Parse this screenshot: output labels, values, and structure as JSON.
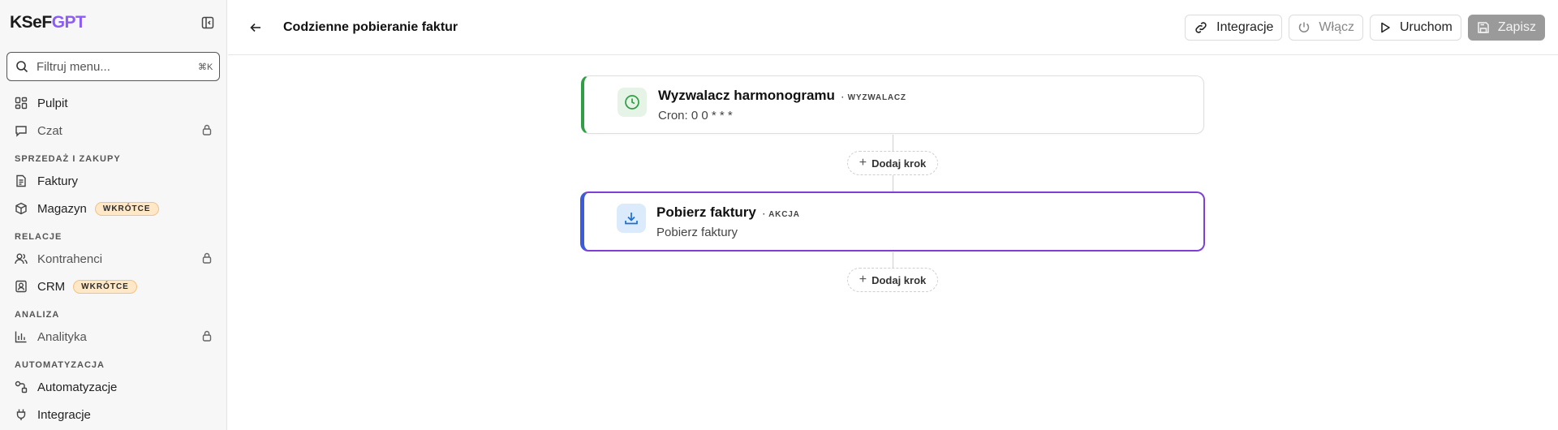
{
  "app": {
    "logo_main": "KSeF",
    "logo_accent": "GPT"
  },
  "search": {
    "placeholder": "Filtruj menu...",
    "shortcut": "⌘K"
  },
  "sidebar": {
    "items_top": [
      {
        "label": "Pulpit",
        "icon": "dashboard-icon",
        "locked": false
      },
      {
        "label": "Czat",
        "icon": "chat-icon",
        "locked": true
      }
    ],
    "sections": [
      {
        "title": "SPRZEDAŻ I ZAKUPY",
        "items": [
          {
            "label": "Faktury",
            "icon": "document-icon",
            "locked": false
          },
          {
            "label": "Magazyn",
            "icon": "box-icon",
            "badge": "WKRÓTCE"
          }
        ]
      },
      {
        "title": "RELACJE",
        "items": [
          {
            "label": "Kontrahenci",
            "icon": "users-icon",
            "locked": true
          },
          {
            "label": "CRM",
            "icon": "contact-icon",
            "badge": "WKRÓTCE"
          }
        ]
      },
      {
        "title": "ANALIZA",
        "items": [
          {
            "label": "Analityka",
            "icon": "bar-chart-icon",
            "locked": true
          }
        ]
      },
      {
        "title": "AUTOMATYZACJA",
        "items": [
          {
            "label": "Automatyzacje",
            "icon": "workflow-icon",
            "locked": false
          },
          {
            "label": "Integracje",
            "icon": "plug-icon",
            "locked": false
          }
        ]
      }
    ]
  },
  "header": {
    "title": "Codzienne pobieranie faktur",
    "buttons": {
      "integrations": "Integracje",
      "enable": "Włącz",
      "run": "Uruchom",
      "save": "Zapisz"
    }
  },
  "workflow": {
    "trigger": {
      "title": "Wyzwalacz harmonogramu",
      "tag": "· WYZWALACZ",
      "subtitle": "Cron: 0 0 * * *"
    },
    "action": {
      "title": "Pobierz faktury",
      "tag": "· AKCJA",
      "subtitle": "Pobierz faktury"
    },
    "add_step_label": "Dodaj krok"
  },
  "colors": {
    "accent_purple": "#8b5cf6",
    "trigger_green": "#2f9e44",
    "action_border": "#7e3fd6",
    "badge_bg": "#ffe8c7"
  }
}
